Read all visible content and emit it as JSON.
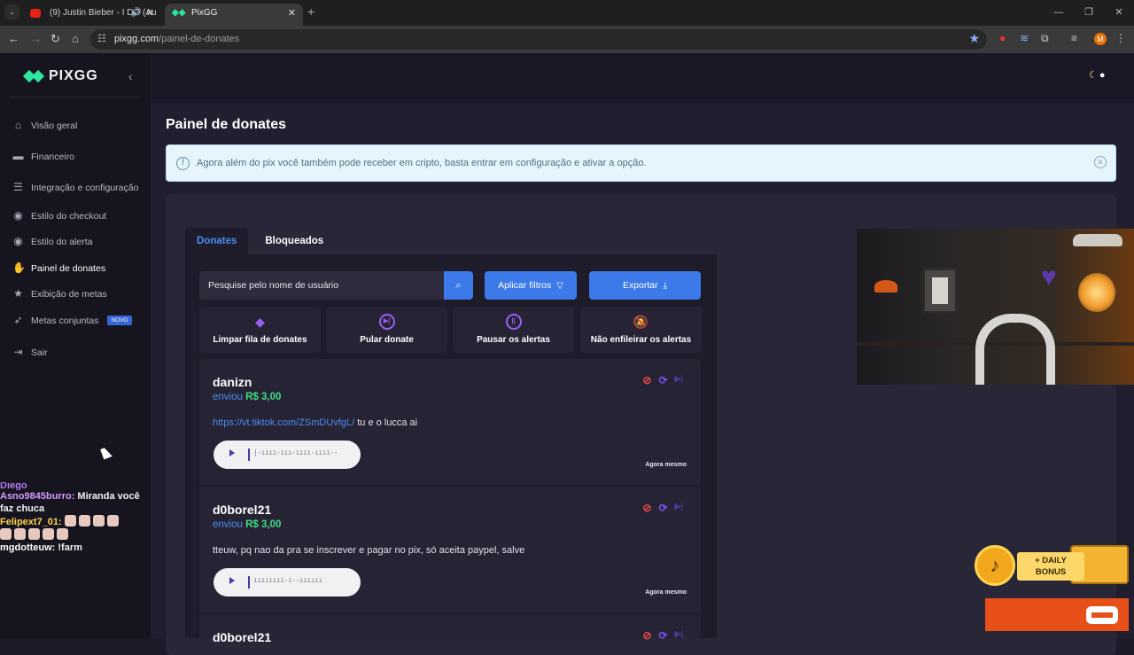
{
  "browser": {
    "tabs": [
      {
        "title": "(9) Justin Bieber - I DO (Au",
        "active": false
      },
      {
        "title": "PixGG",
        "active": true
      }
    ],
    "url_host": "pixgg.com",
    "url_path": "/painel-de-donates",
    "profile_initial": "M"
  },
  "sidebar": {
    "brand": "PIXGG",
    "items": [
      {
        "label": "Visão geral",
        "icon": "home-icon"
      },
      {
        "label": "Financeiro",
        "icon": "wallet-icon"
      },
      {
        "label": "Integração e configuração",
        "icon": "settings-icon"
      },
      {
        "label": "Estilo do checkout",
        "icon": "palette-icon"
      },
      {
        "label": "Estilo do alerta",
        "icon": "palette-icon"
      },
      {
        "label": "Painel de donates",
        "icon": "donate-hand-icon",
        "active": true
      },
      {
        "label": "Exibição de metas",
        "icon": "star-icon"
      },
      {
        "label": "Metas conjuntas",
        "icon": "rocket-icon",
        "badge": "NOVO"
      },
      {
        "label": "Sair",
        "icon": "logout-icon"
      }
    ]
  },
  "chat": {
    "partial_user": "Diego",
    "messages": [
      {
        "user": "Asno9845burro:",
        "text": "Miranda você faz chuca"
      },
      {
        "user": "Felipext7_01:",
        "text": ""
      },
      {
        "user": "mgdotteuw:",
        "text": "!farm"
      }
    ]
  },
  "page": {
    "title": "Painel de donates",
    "info_text": "Agora além do pix você também pode receber em cripto, basta entrar em configuração e ativar a opção.",
    "tabs": [
      "Donates",
      "Bloqueados"
    ],
    "search_placeholder": "Pesquise pelo nome de usuário",
    "filter_label": "Aplicar filtros",
    "export_label": "Exportar",
    "actions": [
      {
        "label": "Limpar fila de donates",
        "icon": "eraser-icon"
      },
      {
        "label": "Pular donate",
        "icon": "skip-icon"
      },
      {
        "label": "Pausar os alertas",
        "icon": "pause-icon"
      },
      {
        "label": "Não enfileirar os alertas",
        "icon": "bell-off-icon"
      }
    ],
    "donations": [
      {
        "user": "danizn",
        "sent_prefix": "enviou",
        "amount": "R$ 3,00",
        "link": "https://vt.tiktok.com/ZSmDUvfgL/",
        "message": " tu e o lucca ai",
        "time": "Agora mesmo"
      },
      {
        "user": "d0borel21",
        "sent_prefix": "enviou",
        "amount": "R$ 3,00",
        "link": "",
        "message": "tteuw, pq nao da pra se inscrever e pagar no pix, só aceita paypel, salve",
        "time": "Agora mesmo"
      },
      {
        "user": "d0borel21"
      }
    ]
  },
  "overlay": {
    "bonus_line1": "+ DAILY",
    "bonus_line2": "BONUS"
  },
  "colors": {
    "accent_blue": "#3b7ae8",
    "brand_green": "#2ee6a0",
    "amount_green": "#3ddc84",
    "icon_purple": "#9b5cf6",
    "block_red": "#e84a4a"
  }
}
